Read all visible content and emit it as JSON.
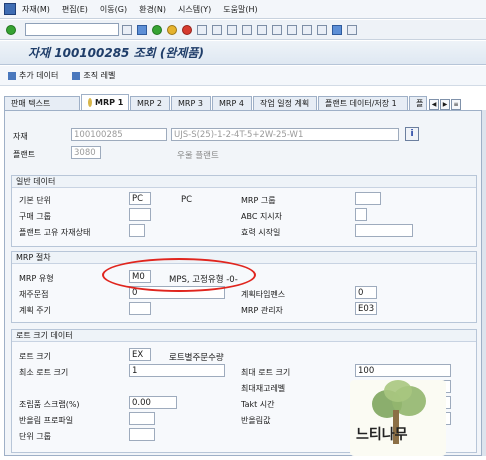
{
  "menu": [
    "자재(M)",
    "편집(E)",
    "이동(G)",
    "환경(N)",
    "시스템(Y)",
    "도움말(H)"
  ],
  "title": "자재 100100285 조회 (완제품)",
  "app_toolbar": {
    "additional_data": "추가 데이터",
    "org_levels": "조직 레벨"
  },
  "tabs": [
    "판매 텍스트",
    "MRP 1",
    "MRP 2",
    "MRP 3",
    "MRP 4",
    "작업 일정 계획",
    "플랜트 데이터/저장 1",
    "플"
  ],
  "header": {
    "material_label": "자재",
    "material_value": "100100285",
    "material_desc": "UJS-S(25)-1-2-4T-5+2W-25-W1",
    "plant_label": "플랜트",
    "plant_value": "3080",
    "plant_desc": "우울 플랜트"
  },
  "general": {
    "title": "일반 데이터",
    "base_unit_label": "기본 단위",
    "base_unit_value": "PC",
    "base_unit_text": "PC",
    "mrp_group_label": "MRP 그룹",
    "purch_group_label": "구매 그룹",
    "abc_label": "ABC 지시자",
    "plant_status_label": "플랜트 고유 자재상태",
    "valid_from_label": "효력 시작일"
  },
  "mrp": {
    "title": "MRP 절차",
    "type_label": "MRP 유형",
    "type_value": "M0",
    "type_text": "MPS, 고정유형 -0-",
    "reorder_label": "재주문점",
    "reorder_value": "0",
    "planning_fence_label": "계획타임펜스",
    "planning_fence_value": "0",
    "cycle_label": "계획 주기",
    "controller_label": "MRP 관리자",
    "controller_value": "E03"
  },
  "lotsize": {
    "title": "로트 크기 데이터",
    "lotsize_label": "로트 크기",
    "lotsize_value": "EX",
    "lotsize_text": "로트별주문수량",
    "min_label": "최소 로트 크기",
    "min_value": "1",
    "max_label": "최대 로트 크기",
    "max_value": "100",
    "maxstock_label": "최대재고레벨",
    "scrap_label": "조립품 스크랩(%)",
    "scrap_value": "0.00",
    "takt_label": "Takt 시간",
    "rounding_profile_label": "반올림 프로파일",
    "rounding_value_label": "반올림값",
    "unit_group_label": "단위 그룹"
  },
  "logo": {
    "text": "느티나무"
  }
}
